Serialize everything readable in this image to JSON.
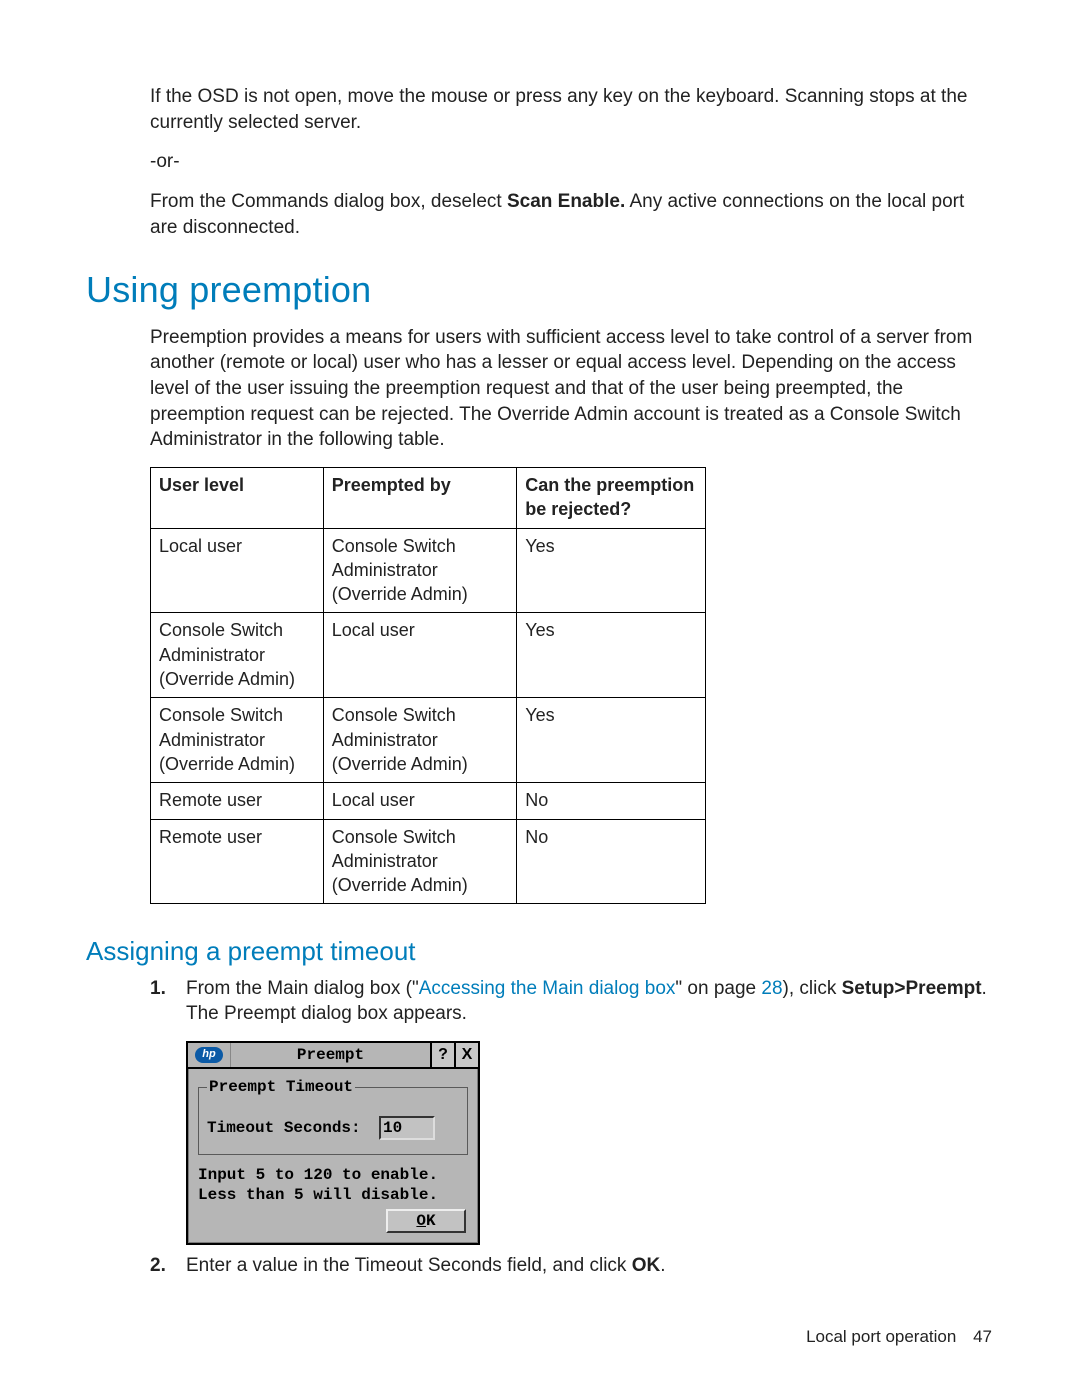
{
  "intro": {
    "p1": "If the OSD is not open, move the mouse or press any key on the keyboard. Scanning stops at the currently selected server.",
    "or": "-or-",
    "p2_pre": "From the Commands dialog box, deselect ",
    "p2_bold": "Scan Enable.",
    "p2_post": " Any active connections on the local port are disconnected."
  },
  "section": {
    "title": "Using preemption",
    "para": "Preemption provides a means for users with sufficient access level to take control of a server from another (remote or local) user who has a lesser or equal access level. Depending on the access level of the user issuing the preemption request and that of the user being preempted, the preemption request can be rejected. The Override Admin account is treated as a Console Switch Administrator in the following table."
  },
  "table": {
    "headers": [
      "User level",
      "Preempted by",
      "Can the preemption be rejected?"
    ],
    "rows": [
      [
        "Local user",
        "Console Switch Administrator (Override Admin)",
        "Yes"
      ],
      [
        "Console Switch Administrator (Override Admin)",
        "Local user",
        "Yes"
      ],
      [
        "Console Switch Administrator (Override Admin)",
        "Console Switch Administrator (Override Admin)",
        "Yes"
      ],
      [
        "Remote user",
        "Local user",
        "No"
      ],
      [
        "Remote user",
        "Console Switch Administrator (Override Admin)",
        "No"
      ]
    ]
  },
  "subsection": {
    "title": "Assigning a preempt timeout",
    "step1": {
      "pre": "From the Main dialog box (\"",
      "link": "Accessing the Main dialog box",
      "mid": "\" on page ",
      "page": "28",
      "post1": "), click ",
      "bold": "Setup>Preempt",
      "post2": ". The Preempt dialog box appears."
    },
    "step2": {
      "pre": "Enter a value in the Timeout Seconds field, and click ",
      "bold": "OK",
      "post": "."
    }
  },
  "dialog": {
    "logo_text": "hp",
    "title": "Preempt",
    "help": "?",
    "close": "X",
    "legend": "Preempt Timeout",
    "label": "Timeout Seconds:",
    "value": "10",
    "hint1": "Input 5 to 120 to enable.",
    "hint2": "Less than 5 will disable.",
    "ok": "OK"
  },
  "footer": {
    "text": "Local port operation",
    "page": "47"
  }
}
